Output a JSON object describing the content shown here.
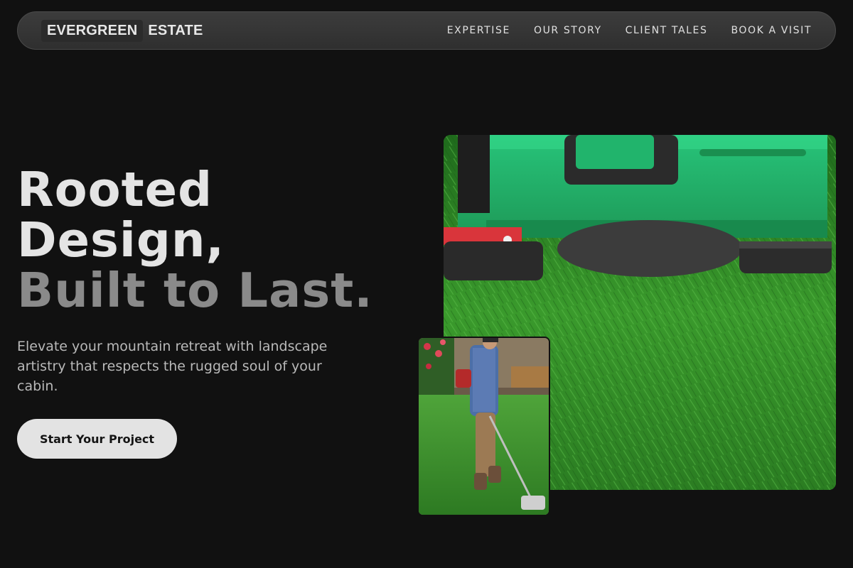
{
  "nav": {
    "logo_word_1": "EVERGREEN",
    "logo_word_2": "ESTATE",
    "links": [
      "EXPERTISE",
      "OUR STORY",
      "CLIENT TALES",
      "BOOK A VISIT"
    ]
  },
  "hero": {
    "title_line_1": "Rooted",
    "title_line_2": "Design,",
    "title_line_3": "Built to Last.",
    "subtitle": "Elevate your mountain retreat with landscape artistry that respects the rugged soul of your cabin.",
    "cta_label": "Start Your Project"
  },
  "images": {
    "main": "lawn-mower-on-grass-photo",
    "secondary": "man-trimming-lawn-photo"
  },
  "colors": {
    "background": "#111111",
    "nav_background": "#333333",
    "cta_background": "#e3e3e3",
    "title_muted": "#8a8a8a"
  }
}
